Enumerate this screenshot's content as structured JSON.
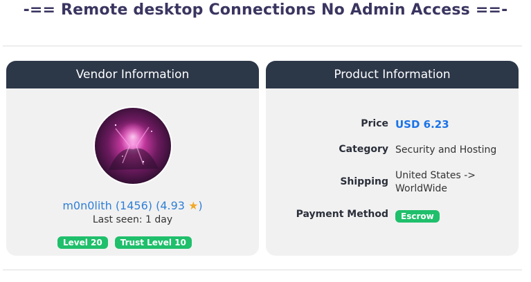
{
  "page": {
    "title": "-== Remote desktop Connections No Admin Access ==-"
  },
  "vendor": {
    "header": "Vendor Information",
    "name": "m0n0lith",
    "sales": "(1456)",
    "rating": "(4.93",
    "rating_star": "★",
    "rating_close": ")",
    "last_seen": "Last seen: 1 day",
    "badges": [
      "Level 20",
      "Trust Level 10"
    ]
  },
  "product": {
    "header": "Product Information",
    "price_label": "Price",
    "price_value": "USD 6.23",
    "category_label": "Category",
    "category_value": "Security and Hosting",
    "shipping_label": "Shipping",
    "shipping_from": "United States ->",
    "shipping_to": "WorldWide",
    "payment_label": "Payment Method",
    "payment_value": "Escrow"
  },
  "colors": {
    "header_bg": "#2c3748",
    "card_bg": "#f1f1f1",
    "badge_green": "#1fbf6b",
    "link_blue": "#2f7fd6",
    "price_blue": "#1a73e8",
    "star": "#f0a92a"
  }
}
